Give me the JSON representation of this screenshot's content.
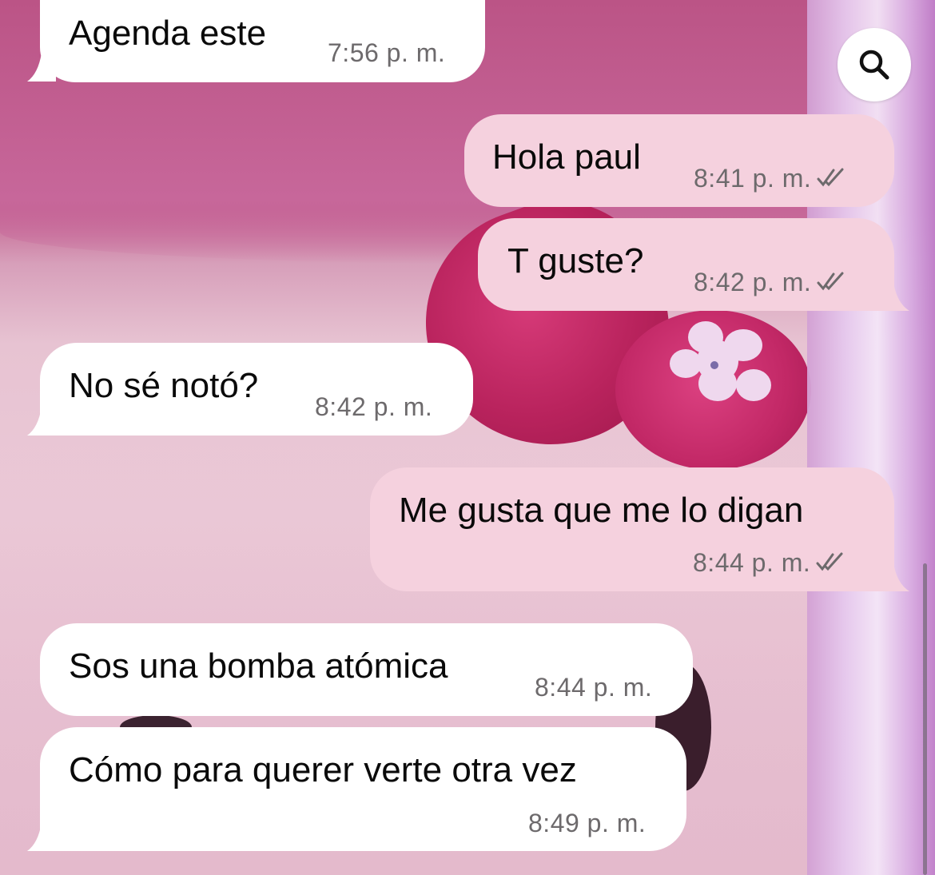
{
  "chat": {
    "search_icon": "search-icon",
    "messages": [
      {
        "direction": "incoming",
        "text": "Agenda este",
        "time": "7:56 p. m."
      },
      {
        "direction": "outgoing",
        "text": "Hola paul",
        "time": "8:41 p. m.",
        "status": "read"
      },
      {
        "direction": "outgoing",
        "text": "T guste?",
        "time": "8:42 p. m.",
        "status": "read"
      },
      {
        "direction": "incoming",
        "text": "No sé notó?",
        "time": "8:42 p. m."
      },
      {
        "direction": "outgoing",
        "text": "Me gusta que me lo digan",
        "time": "8:44 p. m.",
        "status": "read"
      },
      {
        "direction": "incoming",
        "text": "Sos una bomba atómica",
        "time": "8:44 p. m."
      },
      {
        "direction": "incoming",
        "text": "Cómo para querer verte otra vez",
        "time": "8:49 p. m."
      }
    ]
  },
  "colors": {
    "incoming_bubble": "#ffffff",
    "outgoing_bubble": "#f5d1de",
    "time_text": "#6d6a6c",
    "message_text": "#0a0a0a"
  }
}
